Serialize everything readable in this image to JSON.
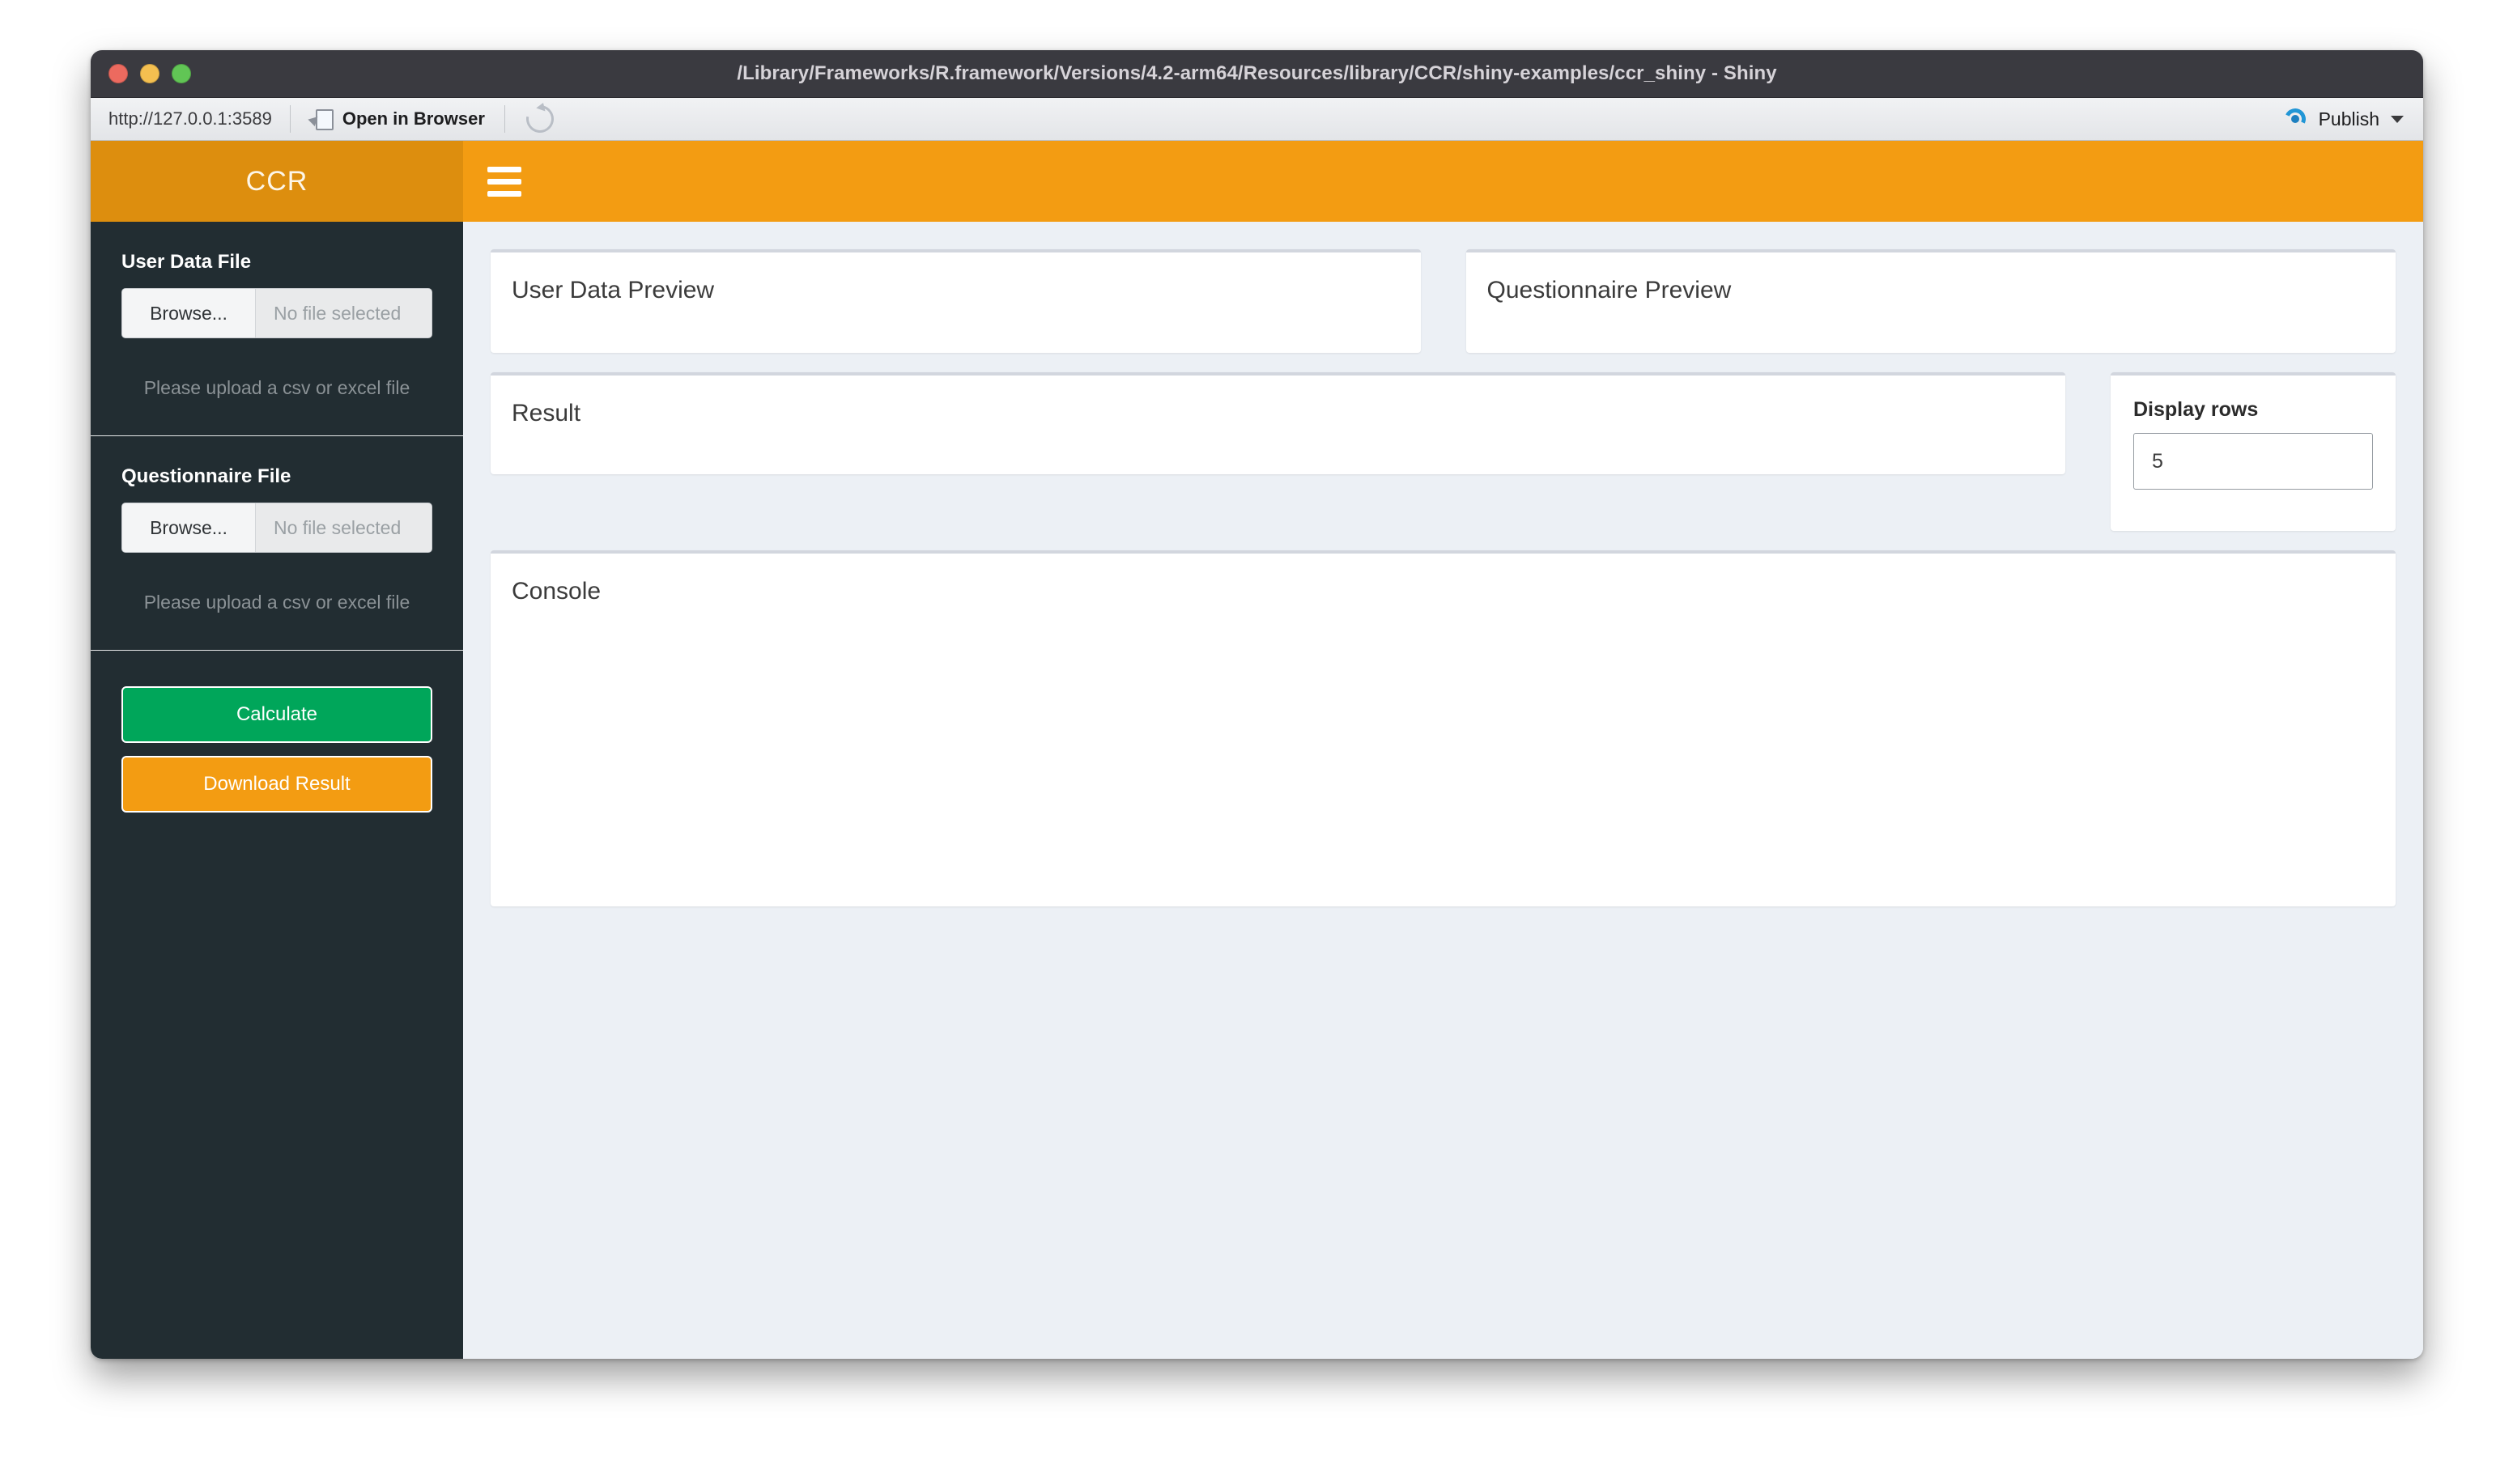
{
  "window": {
    "title": "/Library/Frameworks/R.framework/Versions/4.2-arm64/Resources/library/CCR/shiny-examples/ccr_shiny - Shiny",
    "traffic_lights": [
      "close-red",
      "minimize-yellow",
      "zoom-green"
    ]
  },
  "toolbar": {
    "url": "http://127.0.0.1:3589",
    "open_in_browser_label": "Open in Browser",
    "open_in_browser_icon": "open-external-icon",
    "reload_icon": "reload-icon",
    "publish_label": "Publish",
    "publish_icon": "publish-icon",
    "publish_caret_icon": "chevron-down-icon"
  },
  "sidebar": {
    "logo": "CCR",
    "sections": [
      {
        "label": "User Data File",
        "browse_label": "Browse...",
        "file_name": "No file selected",
        "hint": "Please upload a csv or excel file"
      },
      {
        "label": "Questionnaire File",
        "browse_label": "Browse...",
        "file_name": "No file selected",
        "hint": "Please upload a csv or excel file"
      }
    ],
    "buttons": {
      "calculate": "Calculate",
      "download": "Download Result"
    }
  },
  "navbar": {
    "toggle_icon": "hamburger-menu-icon"
  },
  "main": {
    "boxes": {
      "user_data_preview": "User Data Preview",
      "questionnaire_preview": "Questionnaire Preview",
      "result": "Result",
      "console": "Console"
    },
    "display_rows": {
      "label": "Display rows",
      "value": "5"
    }
  },
  "colors": {
    "navbar_orange": "#f39c12",
    "logo_orange": "#dd8e0e",
    "sidebar_dark": "#222d32",
    "content_bg": "#ecf0f5",
    "calculate_green": "#00a65a",
    "download_orange": "#f39c12",
    "box_top_border": "#d2d6de",
    "publish_blue": "#2196d6"
  }
}
